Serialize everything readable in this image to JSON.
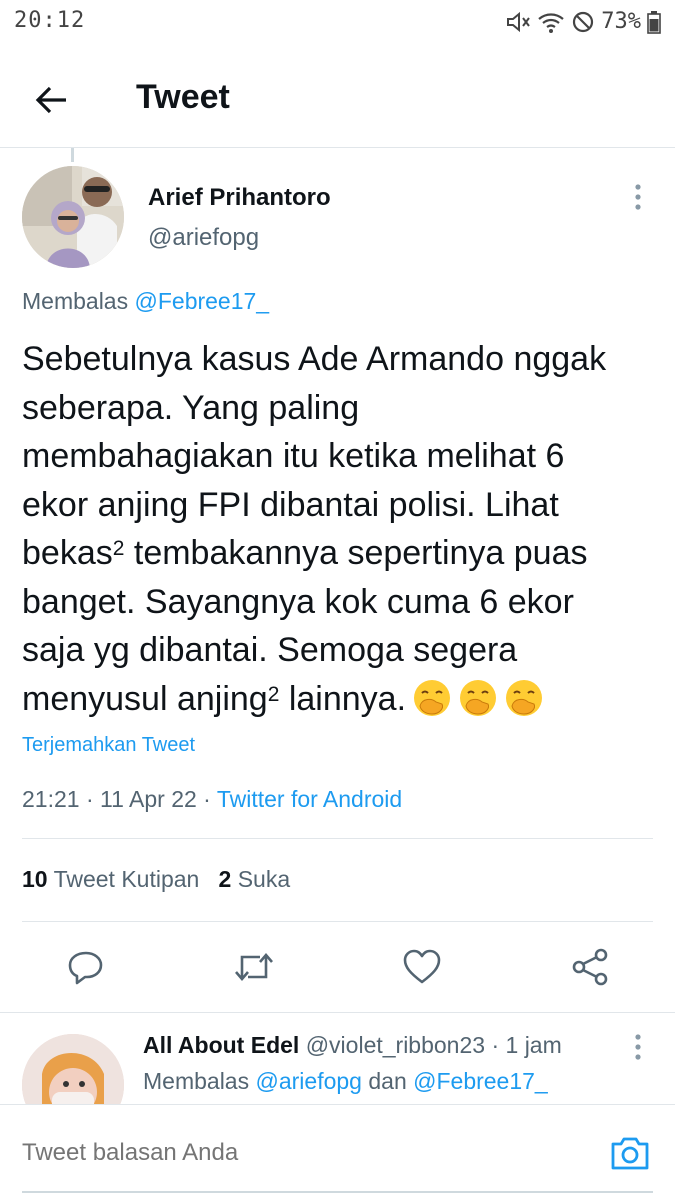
{
  "status_bar": {
    "time": "20:12",
    "battery": "73%",
    "icons": [
      "mute-icon",
      "wifi-icon",
      "dnd-icon",
      "battery-icon"
    ]
  },
  "header": {
    "title": "Tweet",
    "back_icon": "arrow-left-icon"
  },
  "main_tweet": {
    "author_name": "Arief Prihantoro",
    "author_handle": "@ariefopg",
    "reply_prefix": "Membalas",
    "reply_to": "@Febree17_",
    "text_lines": [
      "Sebetulnya kasus Ade Armando nggak",
      "seberapa. Yang paling",
      "membahagiakan itu ketika melihat 6",
      "ekor anjing FPI dibantai polisi.  Lihat",
      "bekas",
      " tembakannya sepertinya puas",
      "banget. Sayangnya kok cuma 6 ekor",
      "saja yg dibantai. Semoga segera",
      "menyusul anjing",
      " lainnya."
    ],
    "superscript": "2",
    "emoji_icon": "face-with-hand-over-mouth-emoji",
    "emoji_count": 3,
    "translate_label": "Terjemahkan Tweet",
    "time": "21:21",
    "date": "11 Apr 22",
    "separator": "·",
    "source": "Twitter for Android",
    "quote_count": "10",
    "quote_label": "Tweet Kutipan",
    "like_count": "2",
    "like_label": "Suka"
  },
  "actions": [
    "reply-icon",
    "retweet-icon",
    "like-icon",
    "share-icon"
  ],
  "reply_tweet": {
    "author_name": "All About Edel",
    "author_handle": "@violet_ribbon23",
    "separator": "·",
    "time_ago": "1 jam",
    "reply_prefix": "Membalas",
    "reply_to_1": "@ariefopg",
    "conjunction": "dan",
    "reply_to_2": "@Febree17_"
  },
  "composer": {
    "placeholder": "Tweet balasan Anda",
    "camera_icon": "camera-icon"
  },
  "colors": {
    "accent": "#1d9bf0",
    "text": "#0f1419",
    "secondary": "#536471",
    "divider": "#e1e6ea"
  }
}
